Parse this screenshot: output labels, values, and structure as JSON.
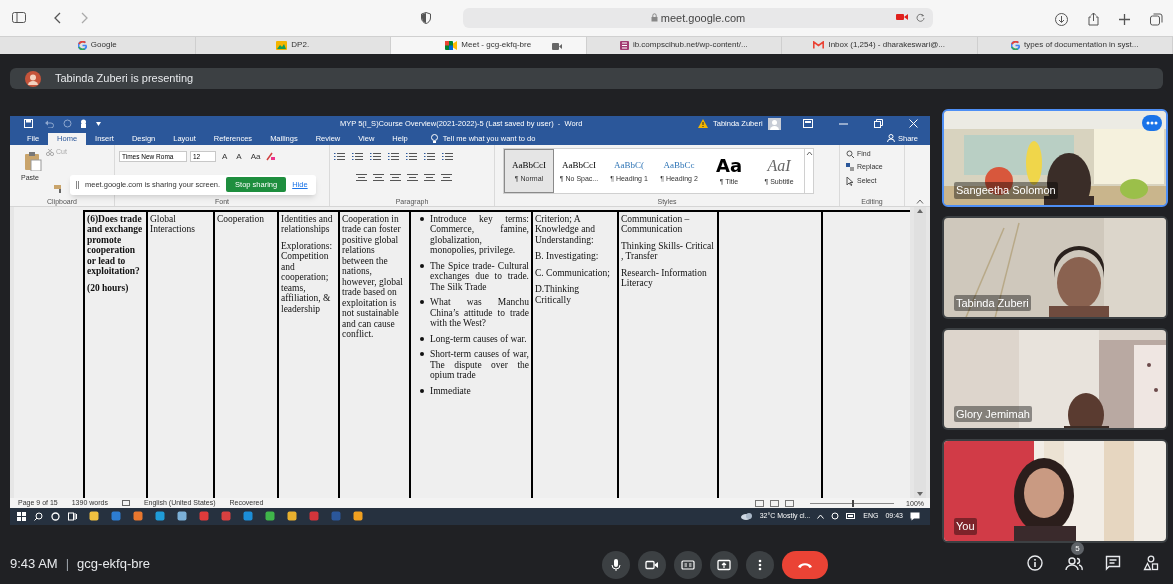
{
  "browser": {
    "url": "meet.google.com",
    "tabs": [
      {
        "label": "Google",
        "selected": false
      },
      {
        "label": "DP2.",
        "selected": false
      },
      {
        "label": "Meet - gcg-ekfq-bre",
        "selected": true
      },
      {
        "label": "ib.compscihub.net/wp-content/...",
        "selected": false
      },
      {
        "label": "Inbox (1,254) - dharakeswari@...",
        "selected": false
      },
      {
        "label": "types of documentation in syst...",
        "selected": false
      }
    ]
  },
  "presenting_banner": "Tabinda Zuberi is presenting",
  "word": {
    "title": "MYP 5(I_S)Course Overview(2021-2022)-5 (Last saved by user)  -  Word",
    "user": "Tabinda Zuberi",
    "menu_tabs": [
      {
        "label": "File",
        "selected": false
      },
      {
        "label": "Home",
        "selected": true
      },
      {
        "label": "Insert",
        "selected": false
      },
      {
        "label": "Design",
        "selected": false
      },
      {
        "label": "Layout",
        "selected": false
      },
      {
        "label": "References",
        "selected": false
      },
      {
        "label": "Mailings",
        "selected": false
      },
      {
        "label": "Review",
        "selected": false
      },
      {
        "label": "View",
        "selected": false
      },
      {
        "label": "Help",
        "selected": false
      }
    ],
    "tell_me": "Tell me what you want to do",
    "share": "Share",
    "clipboard": {
      "paste": "Paste",
      "cut": "Cut"
    },
    "font": {
      "name": "Times New Roma",
      "size": "12",
      "buttons": [
        "A",
        "A",
        "Aa"
      ]
    },
    "styles": [
      {
        "preview": "AaBbCcI",
        "name": "¶ Normal",
        "kind": "body",
        "selected": true
      },
      {
        "preview": "AaBbCcI",
        "name": "¶ No Spac...",
        "kind": "body",
        "selected": false
      },
      {
        "preview": "AaBbC(",
        "name": "¶ Heading 1",
        "kind": "heading",
        "selected": false
      },
      {
        "preview": "AaBbCc",
        "name": "¶ Heading 2",
        "kind": "heading",
        "selected": false
      },
      {
        "preview": "Aa",
        "name": "¶ Title",
        "kind": "title",
        "selected": false
      },
      {
        "preview": "AaI",
        "name": "¶ Subtitle",
        "kind": "subtitle",
        "selected": false
      }
    ],
    "editing": [
      "Find",
      "Replace",
      "Select"
    ],
    "group_labels": [
      "Clipboard",
      "Font",
      "Paragraph",
      "Styles",
      "Editing"
    ],
    "share_notice": {
      "message": "meet.google.com is sharing your screen.",
      "stop": "Stop sharing",
      "hide": "Hide"
    },
    "table": {
      "rows": [
        {
          "cells": [
            {
              "kind": "bold-text",
              "paragraphs": [
                "(6)Does trade and exchange promote cooperation or lead to exploitation?",
                "(20 hours)"
              ]
            },
            {
              "kind": "text",
              "paragraphs": [
                "Global Interactions"
              ]
            },
            {
              "kind": "text",
              "paragraphs": [
                "Cooperation"
              ]
            },
            {
              "kind": "text",
              "paragraphs": [
                "Identities and relationships",
                "Explorations: Competition and cooperation; teams, affiliation, & leadership"
              ]
            },
            {
              "kind": "text",
              "paragraphs": [
                "Cooperation in trade can foster positive global relations between the nations, however, global trade based on exploitation is not sustainable and can cause conflict."
              ]
            },
            {
              "kind": "bullets",
              "paragraphs": [
                "Introduce key terms: Commerce, famine, globalization, monopolies, privilege.",
                "The Spice trade- Cultural exchanges due to trade. The Silk Trade",
                "What was Manchu China’s attitude to trade with the West?",
                "Long-term causes of war.",
                "Short-term causes of war, The dispute over the opium trade",
                "Immediate"
              ]
            },
            {
              "kind": "text",
              "paragraphs": [
                "Criterion; A Knowledge and Understanding:",
                "B. Investigating:",
                "C. Communication;",
                "D.Thinking Critically"
              ]
            },
            {
              "kind": "text",
              "paragraphs": [
                "Communication – Communication",
                "Thinking Skills- Critical , Transfer",
                "Research- Information Literacy"
              ]
            },
            {
              "kind": "empty"
            }
          ]
        }
      ]
    },
    "status_bar": {
      "page": "Page 9 of 15",
      "words": "1390 words",
      "language": "English (United States)",
      "state": "Recovered",
      "zoom": "100%",
      "zoom_slider": {
        "level": 0.5
      }
    },
    "taskbar": {
      "weather": "32°C Mostly cl...",
      "language": "ENG",
      "time": "09:43"
    }
  },
  "participants": [
    {
      "name": "Sangeetha Solomon",
      "speaking": true
    },
    {
      "name": "Tabinda Zuberi",
      "speaking": false
    },
    {
      "name": "Glory Jemimah",
      "speaking": false
    },
    {
      "name": "You",
      "speaking": false
    }
  ],
  "bottom_bar": {
    "time": "9:43 AM",
    "separator": "|",
    "meeting_code": "gcg-ekfq-bre",
    "people_count": "5"
  }
}
